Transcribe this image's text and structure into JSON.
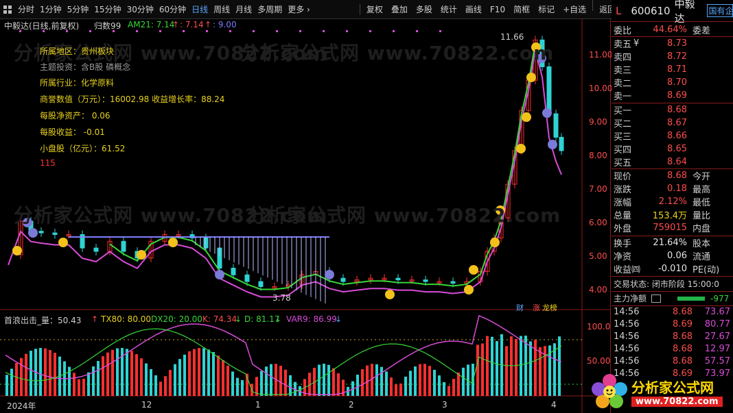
{
  "toolbar": {
    "periods": [
      "分时",
      "1分钟",
      "5分钟",
      "15分钟",
      "30分钟",
      "60分钟",
      "日线",
      "周线",
      "月线",
      "多周期",
      "更多 ›"
    ],
    "active_period": "日线",
    "tools": [
      "复权",
      "叠加",
      "多股",
      "统计",
      "画线",
      "F10",
      "简框",
      "标记",
      "+自选",
      "返回"
    ]
  },
  "chart_header": {
    "name": "中毅达(日线,前复权)",
    "index": "归数99",
    "am_label": "AM21: 7.14",
    "am_arrow1": "↑",
    "am_value2": ": 7.14",
    "am_arrow2": "↑",
    "am_value3": ": 9.00"
  },
  "info_box": {
    "region_key": "所属地区：",
    "region_val": "贵州板块",
    "theme_key": "主题投资：",
    "theme_val": "含B股  磷概念",
    "industry_key": "所属行业：",
    "industry_val": "化学原料",
    "goodwill": "商誉数值（万元）：16002.98  收益增长率：88.24",
    "nav": "每股净资产：  0.06",
    "eps": "每股收益：  -0.01",
    "smallcap": "小盘股（亿元）：61.52",
    "count": "115"
  },
  "price_axis": [
    "11.00",
    "10.00",
    "9.00",
    "8.00",
    "7.00",
    "6.00",
    "5.00",
    "4.00"
  ],
  "annotations": {
    "high": "11.66",
    "low": "3.78",
    "badge_cai": "财",
    "badge_zhang": "涨",
    "badge_long": "龙榜"
  },
  "indicator_header": {
    "name": "首浪出击_量：50.43",
    "up1": "↑",
    "tx80": "TX80: 80.00",
    "dx20": "DX20: 20.00",
    "k": "K: 74.34",
    "kd": "↓",
    "d": "D: 81.17",
    "dd": "↓",
    "var9": "VAR9: 86.99",
    "vd": "↓"
  },
  "indicator_axis": [
    "100.0",
    "50.00"
  ],
  "x_axis": [
    "2024年",
    "12",
    "1",
    "2",
    "3",
    "4"
  ],
  "watermark": "分析家公式网 www.70822.com",
  "quote": {
    "l_mark": "L",
    "code": "600610",
    "name": "中毅达",
    "tag": "国有企",
    "webi_label": "委比",
    "webi_val": "44.64%",
    "weicha_label": "委差",
    "asks": [
      {
        "label": "卖五",
        "val": "8.73",
        "sym": "¥"
      },
      {
        "label": "卖四",
        "val": "8.72",
        "sym": ""
      },
      {
        "label": "卖三",
        "val": "8.71",
        "sym": ""
      },
      {
        "label": "卖二",
        "val": "8.70",
        "sym": ""
      },
      {
        "label": "卖一",
        "val": "8.69",
        "sym": ""
      }
    ],
    "bids": [
      {
        "label": "买一",
        "val": "8.68"
      },
      {
        "label": "买二",
        "val": "8.67"
      },
      {
        "label": "买三",
        "val": "8.66"
      },
      {
        "label": "买四",
        "val": "8.65"
      },
      {
        "label": "买五",
        "val": "8.64"
      }
    ],
    "stats": [
      {
        "l": "现价",
        "v": "8.68",
        "c": "red",
        "l2": "今开"
      },
      {
        "l": "涨跌",
        "v": "0.18",
        "c": "red",
        "l2": "最高"
      },
      {
        "l": "涨幅",
        "v": "2.12%",
        "c": "red",
        "l2": "最低"
      },
      {
        "l": "总量",
        "v": "153.4万",
        "c": "yel",
        "l2": "量比"
      },
      {
        "l": "外盘",
        "v": "759015",
        "c": "red",
        "l2": "内盘"
      }
    ],
    "stats2": [
      {
        "l": "换手",
        "v": "21.64%",
        "c": "wht",
        "l2": "股本"
      },
      {
        "l": "净资",
        "v": "0.06",
        "c": "wht",
        "l2": "流通"
      },
      {
        "l": "收益㈣",
        "v": "-0.010",
        "c": "wht",
        "l2": "PE(动)"
      }
    ],
    "trade_status": "交易状态: 闭市阶段 15:00:0",
    "main_flow_label": "主力净额",
    "main_flow_val": "-977",
    "ticks": [
      {
        "t": "14:56",
        "p": "8.68",
        "c": "red",
        "v": "73.67"
      },
      {
        "t": "14:56",
        "p": "8.69",
        "c": "red",
        "v": "80.77"
      },
      {
        "t": "14:56",
        "p": "8.68",
        "c": "red",
        "v": "27.67"
      },
      {
        "t": "14:56",
        "p": "8.68",
        "c": "red",
        "v": "12.97"
      },
      {
        "t": "14:56",
        "p": "8.68",
        "c": "red",
        "v": "57.57"
      },
      {
        "t": "14:56",
        "p": "8.69",
        "c": "red",
        "v": "73.97"
      }
    ]
  },
  "logo": {
    "text": "分析家公式网",
    "url": "www.70822.com"
  }
}
